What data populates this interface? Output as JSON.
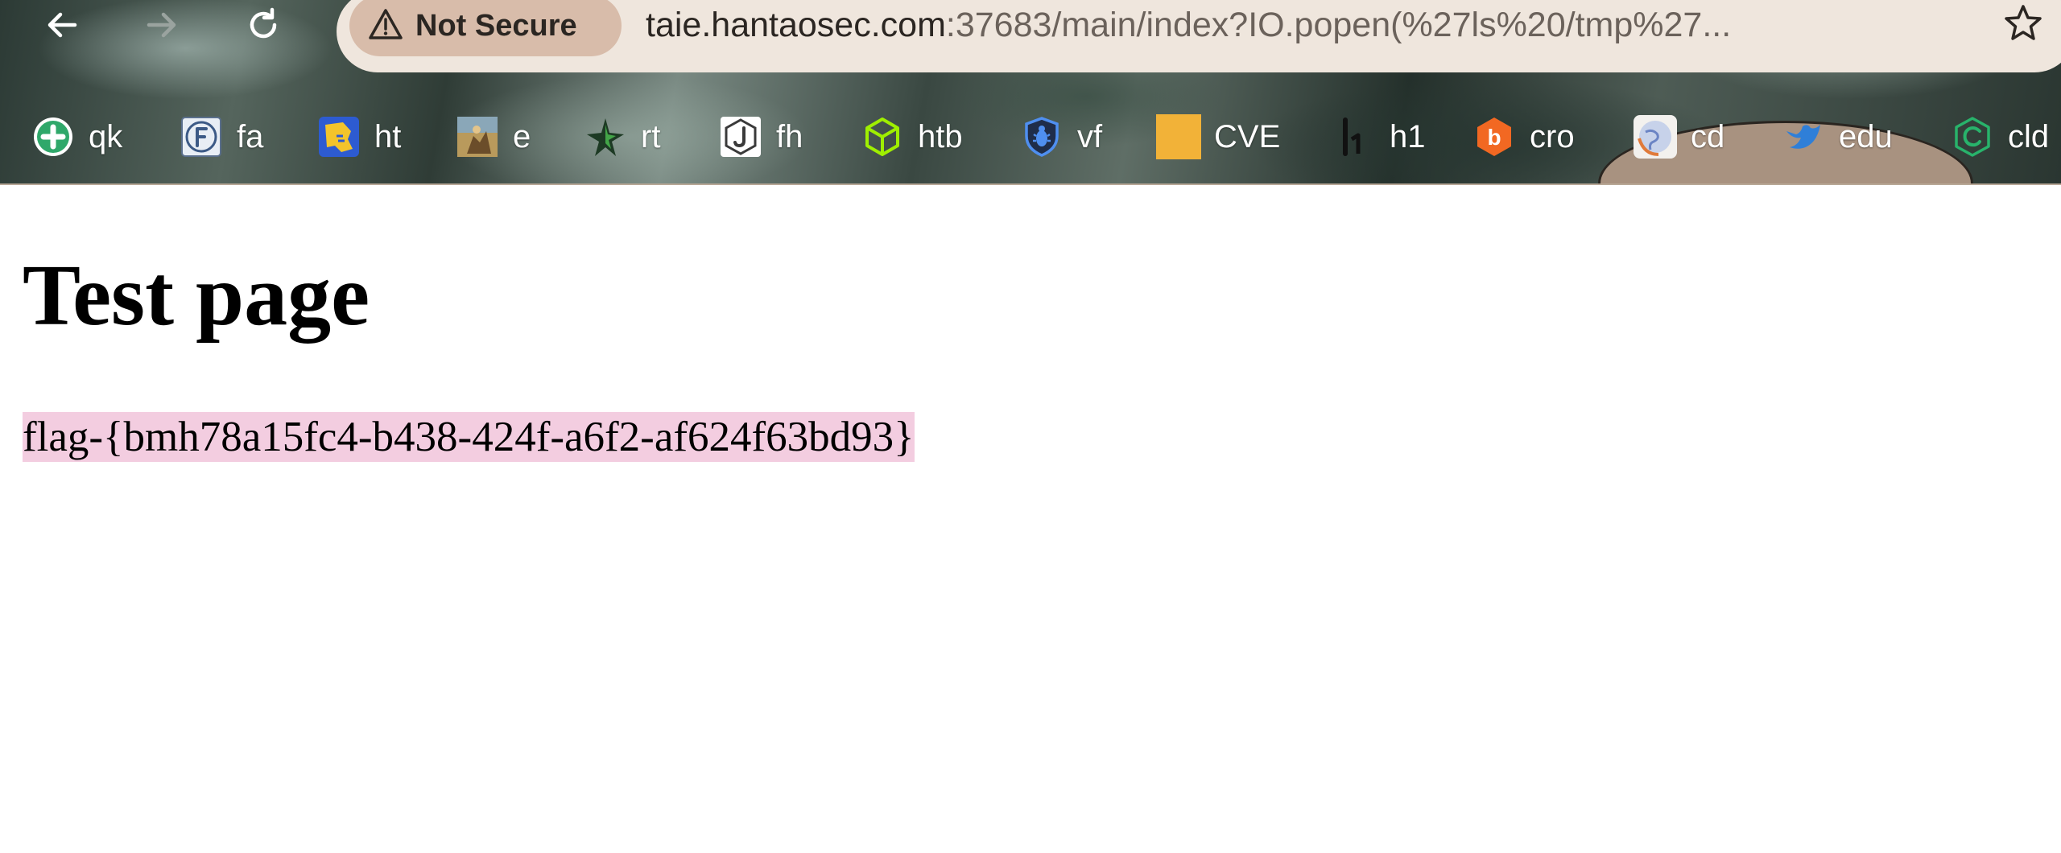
{
  "browser": {
    "security_label": "Not Secure",
    "url_host": "taie.hantaosec.com",
    "url_rest": ":37683/main/index?IO.popen(%27ls%20/tmp%27...",
    "colors": {
      "omnibox_bg": "#efe6dd",
      "security_chip_bg": "#d8bcaa"
    },
    "icons": {
      "back": "arrow-left-icon",
      "forward": "arrow-right-icon",
      "reload": "reload-icon",
      "warning": "warning-triangle-icon",
      "bookmark": "star-icon"
    }
  },
  "bookmarks": [
    {
      "label": "qk",
      "icon": "green-plus-icon"
    },
    {
      "label": "fa",
      "icon": "fa-logo-icon"
    },
    {
      "label": "ht",
      "icon": "yellow-map-icon"
    },
    {
      "label": "e",
      "icon": "game-art-icon"
    },
    {
      "label": "rt",
      "icon": "green-star-icon"
    },
    {
      "label": "fh",
      "icon": "j-logo-icon"
    },
    {
      "label": "htb",
      "icon": "green-cube-icon"
    },
    {
      "label": "vf",
      "icon": "bug-shield-icon"
    },
    {
      "label": "CVE",
      "icon": "orange-square-icon"
    },
    {
      "label": "h1",
      "icon": "h1-logo-icon"
    },
    {
      "label": "cro",
      "icon": "orange-b-icon"
    },
    {
      "label": "cd",
      "icon": "globe-icon"
    },
    {
      "label": "edu",
      "icon": "blue-bird-icon"
    },
    {
      "label": "cld",
      "icon": "green-c-icon"
    }
  ],
  "page": {
    "title": "Test page",
    "flag": "flag-{bmh78a15fc4-b438-424f-a6f2-af624f63bd93}",
    "highlight_color": "#f3cde0"
  }
}
